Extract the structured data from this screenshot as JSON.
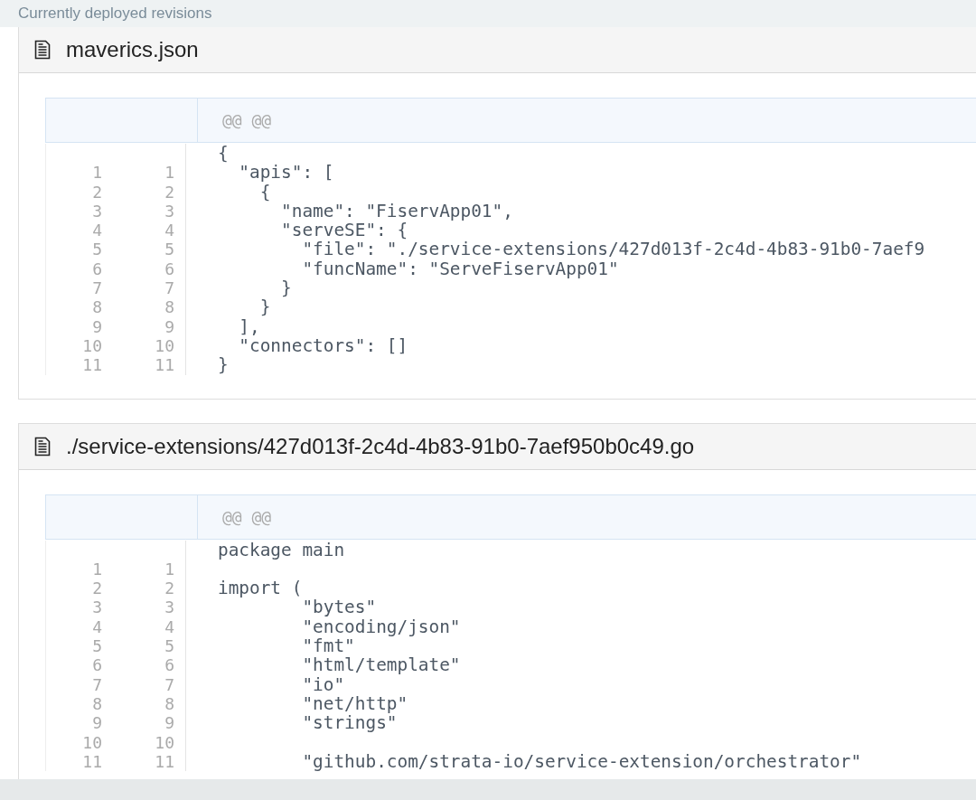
{
  "section_title": "Currently deployed revisions",
  "files": [
    {
      "name": "maverics.json",
      "hunk": "@@ @@",
      "rows": [
        {
          "code": "{"
        },
        {
          "old": "1",
          "new": "1",
          "code": "  \"apis\": ["
        },
        {
          "old": "2",
          "new": "2",
          "code": "    {"
        },
        {
          "old": "3",
          "new": "3",
          "code": "      \"name\": \"FiservApp01\","
        },
        {
          "old": "4",
          "new": "4",
          "code": "      \"serveSE\": {"
        },
        {
          "old": "5",
          "new": "5",
          "code": "        \"file\": \"./service-extensions/427d013f-2c4d-4b83-91b0-7aef9"
        },
        {
          "old": "6",
          "new": "6",
          "code": "        \"funcName\": \"ServeFiservApp01\""
        },
        {
          "old": "7",
          "new": "7",
          "code": "      }"
        },
        {
          "old": "8",
          "new": "8",
          "code": "    }"
        },
        {
          "old": "9",
          "new": "9",
          "code": "  ],"
        },
        {
          "old": "10",
          "new": "10",
          "code": "  \"connectors\": []"
        },
        {
          "old": "11",
          "new": "11",
          "code": "}"
        }
      ]
    },
    {
      "name": "./service-extensions/427d013f-2c4d-4b83-91b0-7aef950b0c49.go",
      "hunk": "@@ @@",
      "rows": [
        {
          "code": "package main"
        },
        {
          "old": "1",
          "new": "1",
          "code": ""
        },
        {
          "old": "2",
          "new": "2",
          "code": "import ("
        },
        {
          "old": "3",
          "new": "3",
          "code": "\t\"bytes\""
        },
        {
          "old": "4",
          "new": "4",
          "code": "\t\"encoding/json\""
        },
        {
          "old": "5",
          "new": "5",
          "code": "\t\"fmt\""
        },
        {
          "old": "6",
          "new": "6",
          "code": "\t\"html/template\""
        },
        {
          "old": "7",
          "new": "7",
          "code": "\t\"io\""
        },
        {
          "old": "8",
          "new": "8",
          "code": "\t\"net/http\""
        },
        {
          "old": "9",
          "new": "9",
          "code": "\t\"strings\""
        },
        {
          "old": "10",
          "new": "10",
          "code": ""
        },
        {
          "old": "11",
          "new": "11",
          "code": "\t\"github.com/strata-io/service-extension/orchestrator\""
        }
      ]
    }
  ]
}
